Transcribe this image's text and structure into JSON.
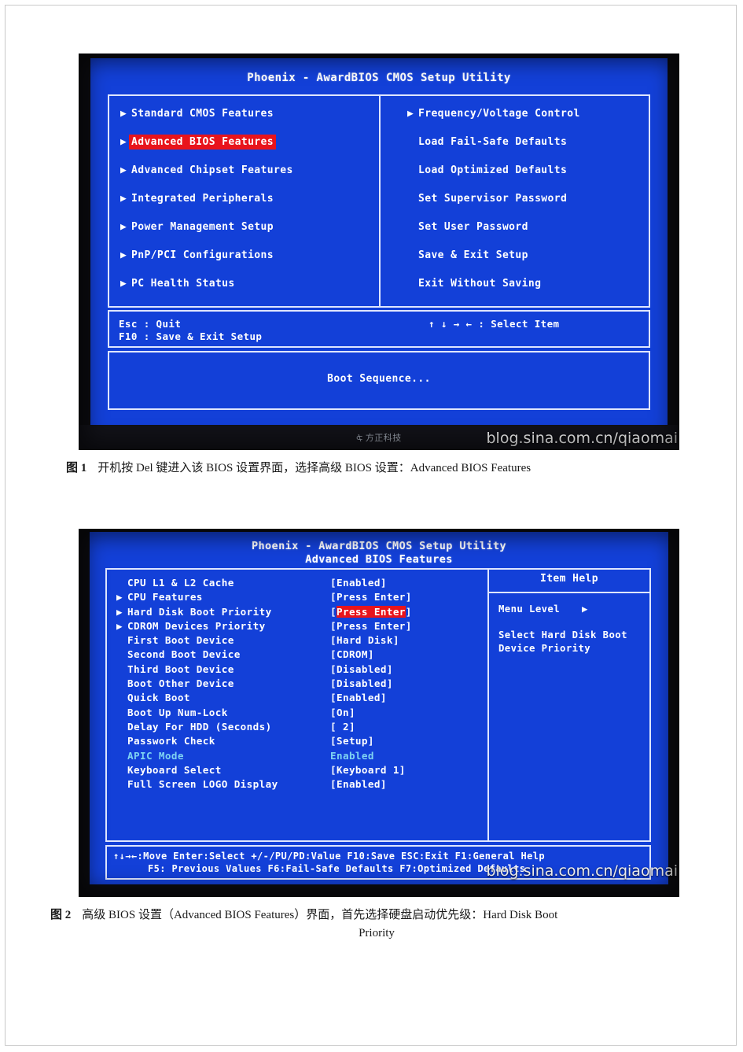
{
  "document": {
    "figures": [
      {
        "id": "figure-1",
        "caption_label": "图 1",
        "caption_text": "开机按 Del 键进入该 BIOS 设置界面，选择高级 BIOS 设置：Advanced BIOS Features",
        "screen": {
          "title": "Phoenix - AwardBIOS CMOS Setup Utility",
          "subtitle": "",
          "left_menu": [
            {
              "label": "Standard CMOS Features",
              "arrow": "▶",
              "selected": false
            },
            {
              "label": "Advanced BIOS Features",
              "arrow": "▶",
              "selected": true
            },
            {
              "label": "Advanced Chipset Features",
              "arrow": "▶",
              "selected": false
            },
            {
              "label": "Integrated Peripherals",
              "arrow": "▶",
              "selected": false
            },
            {
              "label": "Power Management Setup",
              "arrow": "▶",
              "selected": false
            },
            {
              "label": "PnP/PCI Configurations",
              "arrow": "▶",
              "selected": false
            },
            {
              "label": "PC Health Status",
              "arrow": "▶",
              "selected": false
            }
          ],
          "right_menu": [
            {
              "label": "Frequency/Voltage Control",
              "arrow": "▶",
              "selected": false
            },
            {
              "label": "Load Fail-Safe Defaults",
              "arrow": "",
              "selected": false
            },
            {
              "label": "Load Optimized Defaults",
              "arrow": "",
              "selected": false
            },
            {
              "label": "Set Supervisor Password",
              "arrow": "",
              "selected": false
            },
            {
              "label": "Set User Password",
              "arrow": "",
              "selected": false
            },
            {
              "label": "Save & Exit Setup",
              "arrow": "",
              "selected": false
            },
            {
              "label": "Exit Without Saving",
              "arrow": "",
              "selected": false
            }
          ],
          "key_esc": "Esc : Quit",
          "key_f10": "F10 : Save & Exit Setup",
          "key_select": "↑ ↓ → ←   : Select Item",
          "status_line": "Boot Sequence..."
        },
        "bezel": {
          "brand_text": "方正科技",
          "brand_mark": "⊅"
        },
        "watermark": "blog.sina.com.cn/qiaomai"
      },
      {
        "id": "figure-2",
        "caption_label": "图 2",
        "caption_line1": "高级 BIOS 设置（Advanced BIOS Features）界面，首先选择硬盘启动优先级：Hard Disk Boot",
        "caption_line2": "Priority",
        "screen": {
          "title": "Phoenix - AwardBIOS CMOS Setup Utility",
          "subtitle": "Advanced BIOS Features",
          "settings": [
            {
              "arrow": "",
              "name": "CPU L1 & L2 Cache",
              "value": "[Enabled]",
              "highlight": "",
              "dim": false
            },
            {
              "arrow": "▶",
              "name": "CPU Features",
              "value": "[Press Enter]",
              "highlight": "",
              "dim": false
            },
            {
              "arrow": "▶",
              "name": "Hard Disk Boot Priority",
              "value": "[Press Enter]",
              "highlight": "Press Enter",
              "dim": false
            },
            {
              "arrow": "▶",
              "name": "CDROM Devices Priority",
              "value": "[Press Enter]",
              "highlight": "",
              "dim": false
            },
            {
              "arrow": "",
              "name": "First Boot Device",
              "value": "[Hard Disk]",
              "highlight": "",
              "dim": false
            },
            {
              "arrow": "",
              "name": "Second Boot Device",
              "value": "[CDROM]",
              "highlight": "",
              "dim": false
            },
            {
              "arrow": "",
              "name": "Third Boot Device",
              "value": "[Disabled]",
              "highlight": "",
              "dim": false
            },
            {
              "arrow": "",
              "name": "Boot Other Device",
              "value": "[Disabled]",
              "highlight": "",
              "dim": false
            },
            {
              "arrow": "",
              "name": "Quick Boot",
              "value": "[Enabled]",
              "highlight": "",
              "dim": false
            },
            {
              "arrow": "",
              "name": "Boot Up Num-Lock",
              "value": "[On]",
              "highlight": "",
              "dim": false
            },
            {
              "arrow": "",
              "name": "Delay For HDD (Seconds)",
              "value": "[ 2]",
              "highlight": "",
              "dim": false
            },
            {
              "arrow": "",
              "name": "Passwork Check",
              "value": "[Setup]",
              "highlight": "",
              "dim": false
            },
            {
              "arrow": "",
              "name": "APIC Mode",
              "value": "Enabled",
              "highlight": "",
              "dim": true
            },
            {
              "arrow": "",
              "name": "Keyboard Select",
              "value": "[Keyboard 1]",
              "highlight": "",
              "dim": false
            },
            {
              "arrow": "",
              "name": "Full Screen LOGO Display",
              "value": "[Enabled]",
              "highlight": "",
              "dim": false
            }
          ],
          "help_title": "Item Help",
          "help_menu_level": "Menu Level",
          "help_menu_level_arrow": "▶",
          "help_text_line1": "Select Hard Disk Boot",
          "help_text_line2": "Device Priority",
          "footer_line1": "↑↓→←:Move   Enter:Select    +/-/PU/PD:Value   F10:Save   ESC:Exit   F1:General Help",
          "footer_line2": "F5: Previous Values      F6:Fail-Safe Defaults      F7:Optimized Defaults",
          "footer_line3": "F7:Optimized Defaults"
        },
        "watermark": "blog.sina.com.cn/qiaomai"
      }
    ]
  }
}
